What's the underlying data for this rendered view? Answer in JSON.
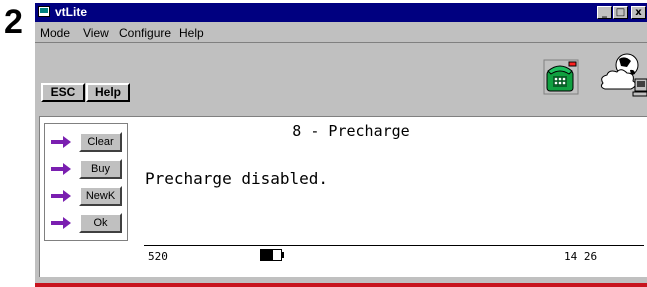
{
  "step": {
    "number": "2"
  },
  "window": {
    "title": "vtLite",
    "controls": {
      "minimize": "_",
      "maximize": "□",
      "close": "x"
    }
  },
  "menu": {
    "items": [
      "Mode",
      "View",
      "Configure",
      "Help"
    ]
  },
  "toolbar": {
    "esc_label": "ESC",
    "help_label": "Help",
    "icons": [
      "phone-icon",
      "network-icon"
    ]
  },
  "softkeys": [
    {
      "label": "Clear"
    },
    {
      "label": "Buy"
    },
    {
      "label": "NewK"
    },
    {
      "label": "Ok"
    }
  ],
  "screen": {
    "title": "8 - Precharge",
    "message": "Precharge disabled.",
    "status_left": "520",
    "status_right": "14 26",
    "battery_level": 0.6
  },
  "colors": {
    "titlebar": "#000080",
    "face": "#c0c0c0",
    "arrow": "#7a1fb0",
    "rule": "#c8141e"
  }
}
